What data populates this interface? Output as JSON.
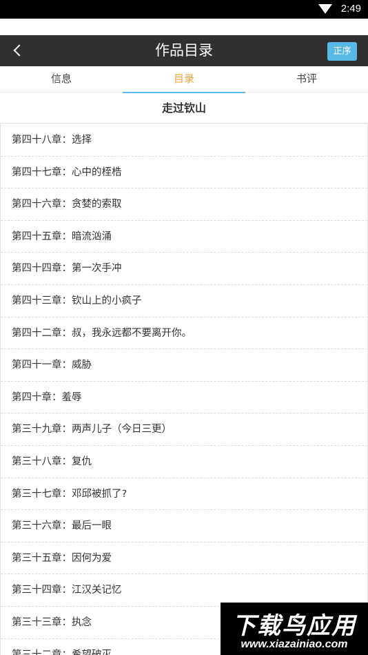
{
  "status_bar": {
    "time": "2:49"
  },
  "header": {
    "title": "作品目录",
    "order_label": "正序"
  },
  "tabs": [
    {
      "label": "信息",
      "active": false
    },
    {
      "label": "目录",
      "active": true
    },
    {
      "label": "书评",
      "active": false
    }
  ],
  "book": {
    "title": "走过钦山"
  },
  "chapters": [
    "第四十八章：选择",
    "第四十七章：心中的桎梏",
    "第四十六章：贪婪的索取",
    "第四十五章：暗流汹涌",
    "第四十四章：第一次手冲",
    "第四十三章：钦山上的小疯子",
    "第四十二章：叔，我永远都不要离开你。",
    "第四十一章：威胁",
    "第四十章：羞辱",
    "第三十九章：两声儿子（今日三更）",
    "第三十八章：复仇",
    "第三十七章：邓邱被抓了?",
    "第三十六章：最后一眼",
    "第三十五章：因何为爱",
    "第三十四章：江汉关记忆",
    "第三十三章：执念",
    "第三十二章：希望破灭"
  ],
  "watermark": {
    "main": "下载鸟应用",
    "url": "www.xiazainiao.com"
  },
  "colors": {
    "header_bg": "#303030",
    "accent_blue": "#5ab8e6",
    "active_tab": "#f1a23a"
  }
}
